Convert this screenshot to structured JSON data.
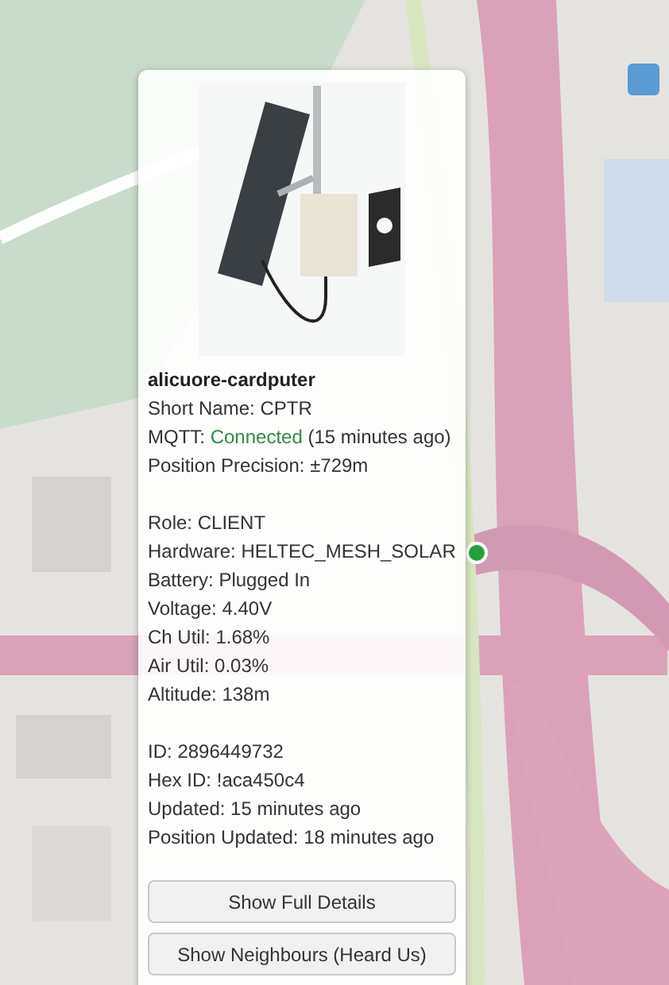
{
  "map": {
    "kind": "picture"
  },
  "marker": {
    "color": "#22a33a"
  },
  "popup": {
    "image": {
      "kind": "picture"
    },
    "title": "alicuore-cardputer",
    "sections": [
      [
        {
          "kind": "field",
          "label": "Short Name:",
          "value": "CPTR"
        },
        {
          "kind": "mqtt",
          "label": "MQTT:",
          "status": "Connected",
          "connected": true,
          "since": "(15 minutes ago)"
        },
        {
          "kind": "field",
          "label": "Position Precision:",
          "value": "±729m"
        }
      ],
      [
        {
          "kind": "field",
          "label": "Role:",
          "value": "CLIENT"
        },
        {
          "kind": "field",
          "label": "Hardware:",
          "value": "HELTEC_MESH_SOLAR"
        },
        {
          "kind": "field",
          "label": "Battery:",
          "value": "Plugged In"
        },
        {
          "kind": "field",
          "label": "Voltage:",
          "value": "4.40V"
        },
        {
          "kind": "field",
          "label": "Ch Util:",
          "value": "1.68%"
        },
        {
          "kind": "field",
          "label": "Air Util:",
          "value": "0.03%"
        },
        {
          "kind": "field",
          "label": "Altitude:",
          "value": "138m"
        }
      ],
      [
        {
          "kind": "field",
          "label": "ID:",
          "value": "2896449732"
        },
        {
          "kind": "field",
          "label": "Hex ID:",
          "value": "!aca450c4"
        },
        {
          "kind": "field",
          "label": "Updated:",
          "value": "15 minutes ago"
        },
        {
          "kind": "field",
          "label": "Position Updated:",
          "value": "18 minutes ago"
        }
      ]
    ],
    "buttons": [
      "Show Full Details",
      "Show Neighbours (Heard Us)"
    ]
  }
}
